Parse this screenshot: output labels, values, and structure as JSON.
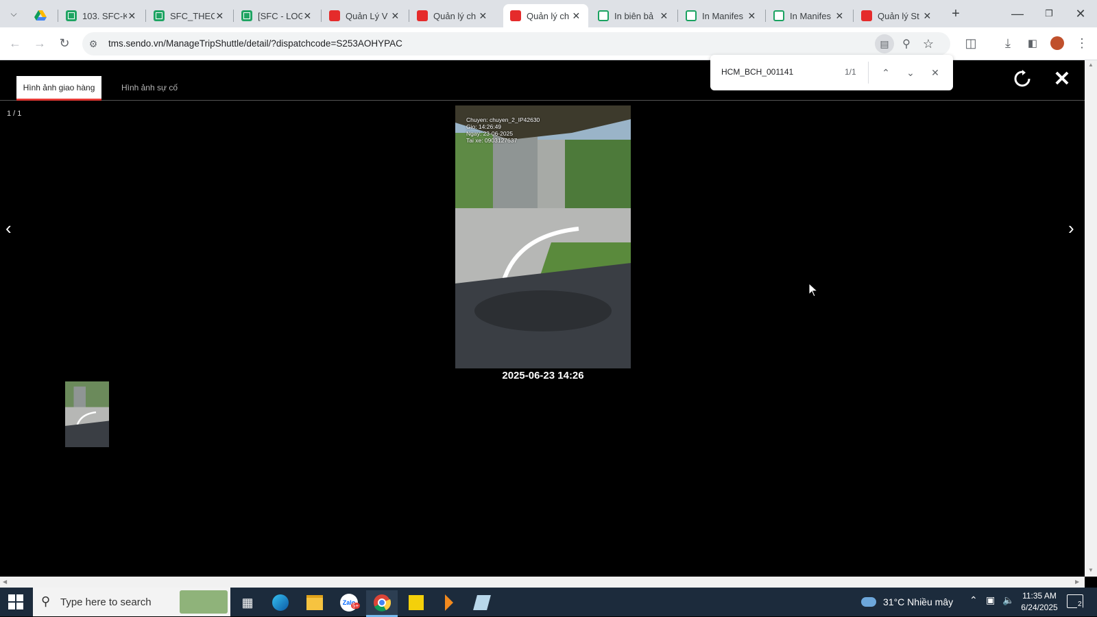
{
  "browser": {
    "tabs": [
      {
        "title": "",
        "icon": "google-drive-icon"
      },
      {
        "title": "103. SFC-K",
        "icon": "sheets-icon"
      },
      {
        "title": "SFC_THEO",
        "icon": "sheets-icon"
      },
      {
        "title": "[SFC - LOG",
        "icon": "sheets-icon"
      },
      {
        "title": "Quản Lý V",
        "icon": "sendo-icon"
      },
      {
        "title": "Quản lý ch",
        "icon": "sendo-icon"
      },
      {
        "title": "Quản lý ch",
        "icon": "sendo-icon",
        "active": true
      },
      {
        "title": "In biên bả",
        "icon": "green-circle-icon"
      },
      {
        "title": "In Manifes",
        "icon": "green-circle-icon"
      },
      {
        "title": "In Manifes",
        "icon": "green-circle-icon"
      },
      {
        "title": "Quản lý St",
        "icon": "sendo-icon"
      }
    ],
    "url": "tms.sendo.vn/ManageTripShuttle/detail/?dispatchcode=S253AOHYPAC"
  },
  "find_bar": {
    "query": "HCM_BCH_001141",
    "count": "1/1"
  },
  "viewer": {
    "tabs": [
      "Hình ảnh giao hàng",
      "Hình ảnh sự cố"
    ],
    "active_tab": 0,
    "counter": "1 / 1",
    "caption": "2025-06-23 14:26",
    "photo_overlay": [
      "Chuyen: chuyen_2_IP42630",
      "Gio: 14:26:49",
      "Ngay: 23-06-2025",
      "Tai xe: 0903127637"
    ]
  },
  "taskbar": {
    "search_placeholder": "Type here to search",
    "weather": "31°C  Nhiều mây",
    "time": "11:35 AM",
    "date": "6/24/2025",
    "notification_count": "2",
    "zalo_badge": "5+"
  },
  "colors": {
    "active_tab_underline": "#e53935",
    "tabstrip_bg": "#dee1e6",
    "taskbar_bg": "#1c2b3c"
  }
}
